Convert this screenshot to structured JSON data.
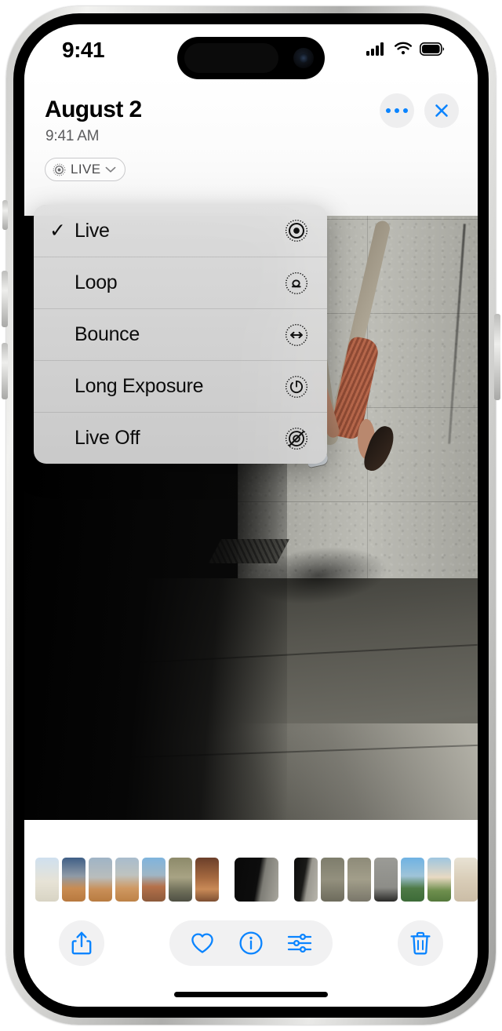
{
  "status_bar": {
    "time": "9:41",
    "cellular_icon": "cellular-bars-icon",
    "wifi_icon": "wifi-icon",
    "battery_icon": "battery-full-icon"
  },
  "header": {
    "title": "August 2",
    "subtitle": "9:41 AM",
    "live_badge": {
      "label": "LIVE",
      "icon": "live-photo-icon",
      "chevron": "chevron-down-icon"
    },
    "more_button_label": "More options",
    "close_button_label": "Close"
  },
  "live_menu": {
    "selected": "Live",
    "check_glyph": "✓",
    "items": [
      {
        "label": "Live",
        "icon": "live-photo-icon",
        "checked": true
      },
      {
        "label": "Loop",
        "icon": "loop-icon",
        "checked": false
      },
      {
        "label": "Bounce",
        "icon": "bounce-icon",
        "checked": false
      },
      {
        "label": "Long Exposure",
        "icon": "long-exposure-icon",
        "checked": false
      },
      {
        "label": "Live Off",
        "icon": "live-off-icon",
        "checked": false
      }
    ]
  },
  "photo": {
    "description": "Person mid-flip in sunlight on a city sidewalk beside a concrete wall"
  },
  "filmstrip": {
    "thumbnails": [
      {
        "name": "thumb-1",
        "selected": false,
        "gradient": "linear-gradient(180deg,#cfe0ef 0%,#e7e3d6 55%,#d8d4c4 100%)"
      },
      {
        "name": "thumb-2",
        "selected": false,
        "gradient": "linear-gradient(180deg,#3f5f86 0%,#8f9aa6 42%,#c98c52 70%,#b8793f 100%)"
      },
      {
        "name": "thumb-3",
        "selected": false,
        "gradient": "linear-gradient(180deg,#9fb4c6 0%,#b9bdbc 45%,#c98f58 72%,#b87c41 100%)"
      },
      {
        "name": "thumb-4",
        "selected": false,
        "gradient": "linear-gradient(180deg,#a8bccd 0%,#bfc3bf 40%,#cf9862 70%,#bd8246 100%)"
      },
      {
        "name": "thumb-5",
        "selected": false,
        "gradient": "linear-gradient(180deg,#7fb4dd 0%,#9fb6c5 40%,#b5714a 66%,#8c5a3b 100%)"
      },
      {
        "name": "thumb-6",
        "selected": false,
        "gradient": "linear-gradient(180deg,#8d8a6a 0%,#a8a384 45%,#6f6f5a 75%,#4f5044 100%)"
      },
      {
        "name": "thumb-7",
        "selected": false,
        "gradient": "linear-gradient(180deg,#6b3f2a 0%,#a4683f 45%,#c98a57 72%,#7d4f32 100%)"
      },
      {
        "name": "thumb-spacer-1",
        "selected": false,
        "spacer": true
      },
      {
        "name": "thumb-8",
        "selected": true,
        "gradient": "linear-gradient(100deg,#090909 0%,#0d0d0d 52%,#7e7d76 64%,#a9a79e 100%)"
      },
      {
        "name": "thumb-spacer-2",
        "selected": false,
        "spacer": true
      },
      {
        "name": "thumb-9",
        "selected": false,
        "gradient": "linear-gradient(100deg,#0c0c0c 0%,#1a1a18 42%,#9a9890 60%,#b9b6ac 100%)"
      },
      {
        "name": "thumb-10",
        "selected": false,
        "gradient": "linear-gradient(180deg,#7e7d6c 0%,#93907e 50%,#6d6b5c 100%)"
      },
      {
        "name": "thumb-11",
        "selected": false,
        "gradient": "linear-gradient(180deg,#8e8b79 0%,#a29e8a 50%,#7a776a 100%)"
      },
      {
        "name": "thumb-12",
        "selected": false,
        "gradient": "linear-gradient(180deg,#9b9b96 0%,#8d8d88 68%,#2a2a28 100%)"
      },
      {
        "name": "thumb-13",
        "selected": false,
        "gradient": "linear-gradient(180deg,#6fb2e3 0%,#9fc4d8 42%,#4e7a46 70%,#3d6b38 100%)"
      },
      {
        "name": "thumb-14",
        "selected": false,
        "gradient": "linear-gradient(180deg,#9fc6e0 0%,#e8d9c2 45%,#6f8f4e 75%,#55793c 100%)"
      },
      {
        "name": "thumb-15",
        "selected": false,
        "gradient": "linear-gradient(180deg,#e8e2d4 0%,#d9cdb8 50%,#cbbda6 100%)"
      }
    ]
  },
  "toolbar": {
    "share_label": "Share",
    "favorite_label": "Favorite",
    "info_label": "Info",
    "adjust_label": "Adjust",
    "delete_label": "Delete",
    "icons": {
      "share": "share-icon",
      "favorite": "heart-icon",
      "info": "info-circle-icon",
      "adjust": "sliders-icon",
      "delete": "trash-icon"
    }
  },
  "theme": {
    "accent_blue": "#0a84ff",
    "menu_bg": "#dcdcdc",
    "chrome_gray": "#f1f1f2"
  },
  "home_indicator": "home-indicator"
}
